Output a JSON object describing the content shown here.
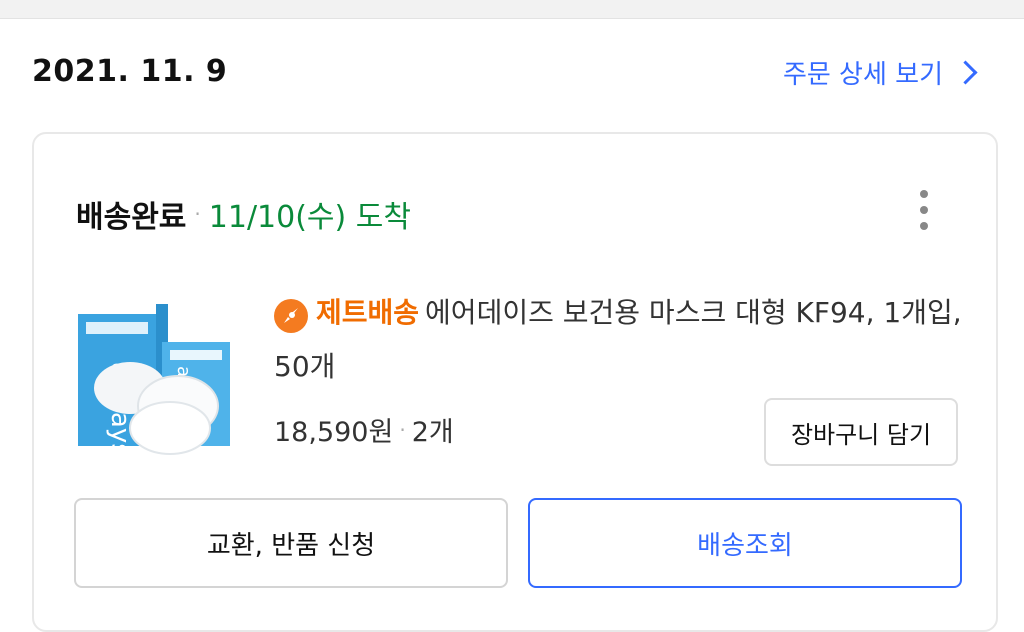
{
  "header": {
    "order_date": "2021. 11. 9",
    "detail_link": "주문 상세 보기"
  },
  "card": {
    "status": "배송완료",
    "separator": "·",
    "arrival": "11/10(수) 도착",
    "product": {
      "badge": "제트배송",
      "title": "에어데이즈 보건용 마스크 대형 KF94, 1개입, 50개",
      "price": "18,590원",
      "quantity": "2개",
      "image_brand": "airdays"
    },
    "cart_button": "장바구니 담기",
    "exchange_button": "교환, 반품 신청",
    "track_button": "배송조회"
  },
  "colors": {
    "accent": "#346aff",
    "delivered": "#0a8a3a",
    "badge": "#f06c00"
  }
}
